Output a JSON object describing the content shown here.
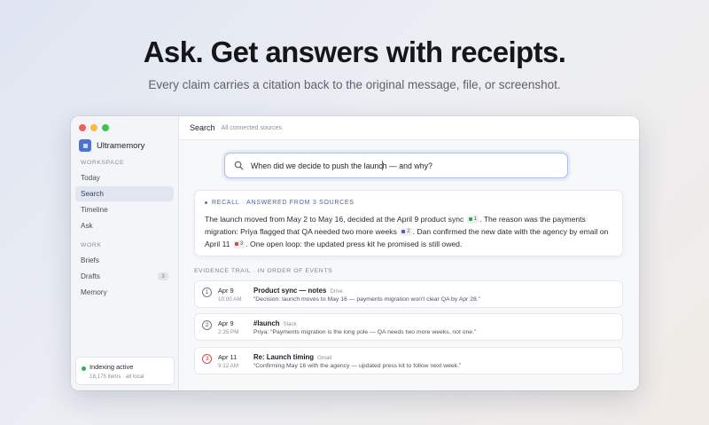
{
  "hero": {
    "title": "Ask. Get answers with receipts.",
    "subtitle": "Every claim carries a citation back to the original message, file, or screenshot."
  },
  "window": {
    "traffic_colors": [
      "#f0605a",
      "#f3bd3f",
      "#3fc34d"
    ]
  },
  "sidebar": {
    "app_name": "Ultramemory",
    "workspace_label": "WORKSPACE",
    "workspace_items": [
      {
        "label": "Today"
      },
      {
        "label": "Search",
        "active": true
      },
      {
        "label": "Timeline"
      },
      {
        "label": "Ask"
      }
    ],
    "work_label": "WORK",
    "work_items": [
      {
        "label": "Briefs"
      },
      {
        "label": "Drafts",
        "badge": "3"
      },
      {
        "label": "Memory"
      }
    ],
    "status": {
      "title": "Indexing active",
      "subtitle": "18,175 items · all local",
      "color": "#2fb44f"
    }
  },
  "topbar": {
    "title": "Search",
    "subtitle": "All connected sources"
  },
  "search": {
    "value": "When did we decide to push the launch — and why?",
    "icon": "search-icon"
  },
  "answer": {
    "label": "RECALL · ANSWERED FROM 3 SOURCES",
    "part1": "The launch moved from May 2 to May 16, decided at the April 9 product sync",
    "cite1": "1",
    "part2": ". The reason was the payments migration: Priya flagged that QA needed two more weeks",
    "cite2": "2",
    "part3": ". Dan confirmed the new date with the agency by email on April 11",
    "cite3": "3",
    "part4": ". One open loop: the updated press kit he promised is still owed.",
    "cite_colors": [
      "#2fa84a",
      "#6a4fc0",
      "#d24a4a"
    ]
  },
  "evidence": {
    "label": "EVIDENCE TRAIL · IN ORDER OF EVENTS",
    "items": [
      {
        "num": "1",
        "date": "Apr 9",
        "time": "10:00 AM",
        "title": "Product sync — notes",
        "source": "Drive",
        "quote": "“Decision: launch moves to May 16 — payments migration won't clear QA by Apr 28.”"
      },
      {
        "num": "2",
        "date": "Apr 9",
        "time": "2:35 PM",
        "title": "#launch",
        "source": "Slack",
        "quote": "Priya: “Payments migration is the long pole — QA needs two more weeks, not one.”"
      },
      {
        "num": "3",
        "date": "Apr 11",
        "time": "9:12 AM",
        "title": "Re: Launch timing",
        "source": "Gmail",
        "quote": "“Confirming May 16 with the agency — updated press kit to follow next week.”"
      }
    ]
  }
}
